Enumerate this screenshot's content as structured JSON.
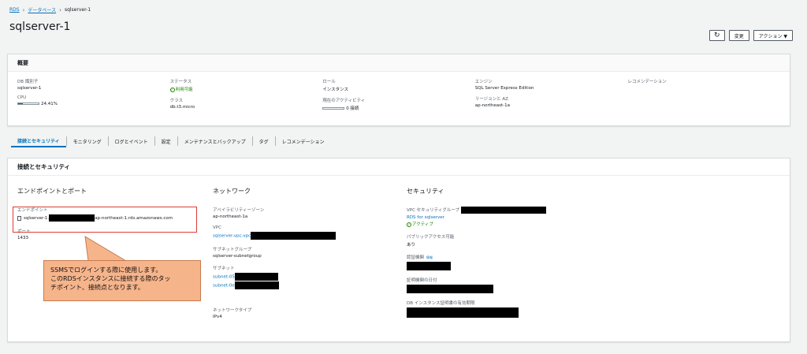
{
  "breadcrumb": {
    "rds": "RDS",
    "databases": "データベース",
    "current": "sqlserver-1"
  },
  "page_title": "sqlserver-1",
  "actions": {
    "refresh_icon": "refresh-icon",
    "modify": "変更",
    "actions": "アクション ▼"
  },
  "summary": {
    "header": "概要",
    "db_id_label": "DB 識別子",
    "db_id": "sqlserver-1",
    "cpu_label": "CPU",
    "cpu_value": "24.41%",
    "cpu_fraction": 0.2441,
    "status_label": "ステータス",
    "status": "利用可能",
    "class_label": "クラス",
    "class": "db.t3.micro",
    "role_label": "ロール",
    "role": "インスタンス",
    "activity_label": "現在のアクティビティ",
    "activity": "0 接続",
    "engine_label": "エンジン",
    "engine": "SQL Server Express Edition",
    "region_label": "リージョンと AZ",
    "region": "ap-northeast-1a",
    "recommend_label": "レコメンデーション"
  },
  "tabs": [
    "接続とセキュリティ",
    "モニタリング",
    "ログとイベント",
    "設定",
    "メンテナンスとバックアップ",
    "タグ",
    "レコメンデーション"
  ],
  "connection": {
    "header": "接続とセキュリティ",
    "endpoint_section": "エンドポイントとポート",
    "endpoint_label": "エンドポイント",
    "endpoint_prefix": "sqlserver-1.",
    "endpoint_suffix": "ap-northeast-1.rds.amazonaws.com",
    "port_label": "ポート",
    "port": "1433",
    "network_section": "ネットワーク",
    "az_label": "アベイラビリティーゾーン",
    "az": "ap-northeast-1a",
    "vpc_label": "VPC",
    "vpc": "sqlserver-vpc-vpc",
    "subnet_group_label": "サブネットグループ",
    "subnet_group": "sqlserver-subnetgroup",
    "subnet_label": "サブネット",
    "subnet1": "subnet-05",
    "subnet2": "subnet-0e",
    "network_type_label": "ネットワークタイプ",
    "network_type": "IPv4",
    "security_section": "セキュリティ",
    "sg_label": "VPC セキュリティグループ",
    "sg": "RDS for sqlserver",
    "sg_status": "アクティブ",
    "public_label": "パブリックアクセス可能",
    "public": "あり",
    "ca_label": "認証機関",
    "ca_info": "情報",
    "ca_date_label": "証明機関の日付",
    "cert_expiry_label": "DB インスタンス証明書の有効期限"
  },
  "callout": {
    "line1": "SSMSでログインする際に使用します。",
    "line2": "このRDSインスタンスに接続する際のタッ",
    "line3": "チポイント、接続点となります。"
  },
  "colors": {
    "link": "#0073bb",
    "success": "#1d8102",
    "callout_bg": "#f6b48b",
    "highlight": "#e03c31"
  }
}
